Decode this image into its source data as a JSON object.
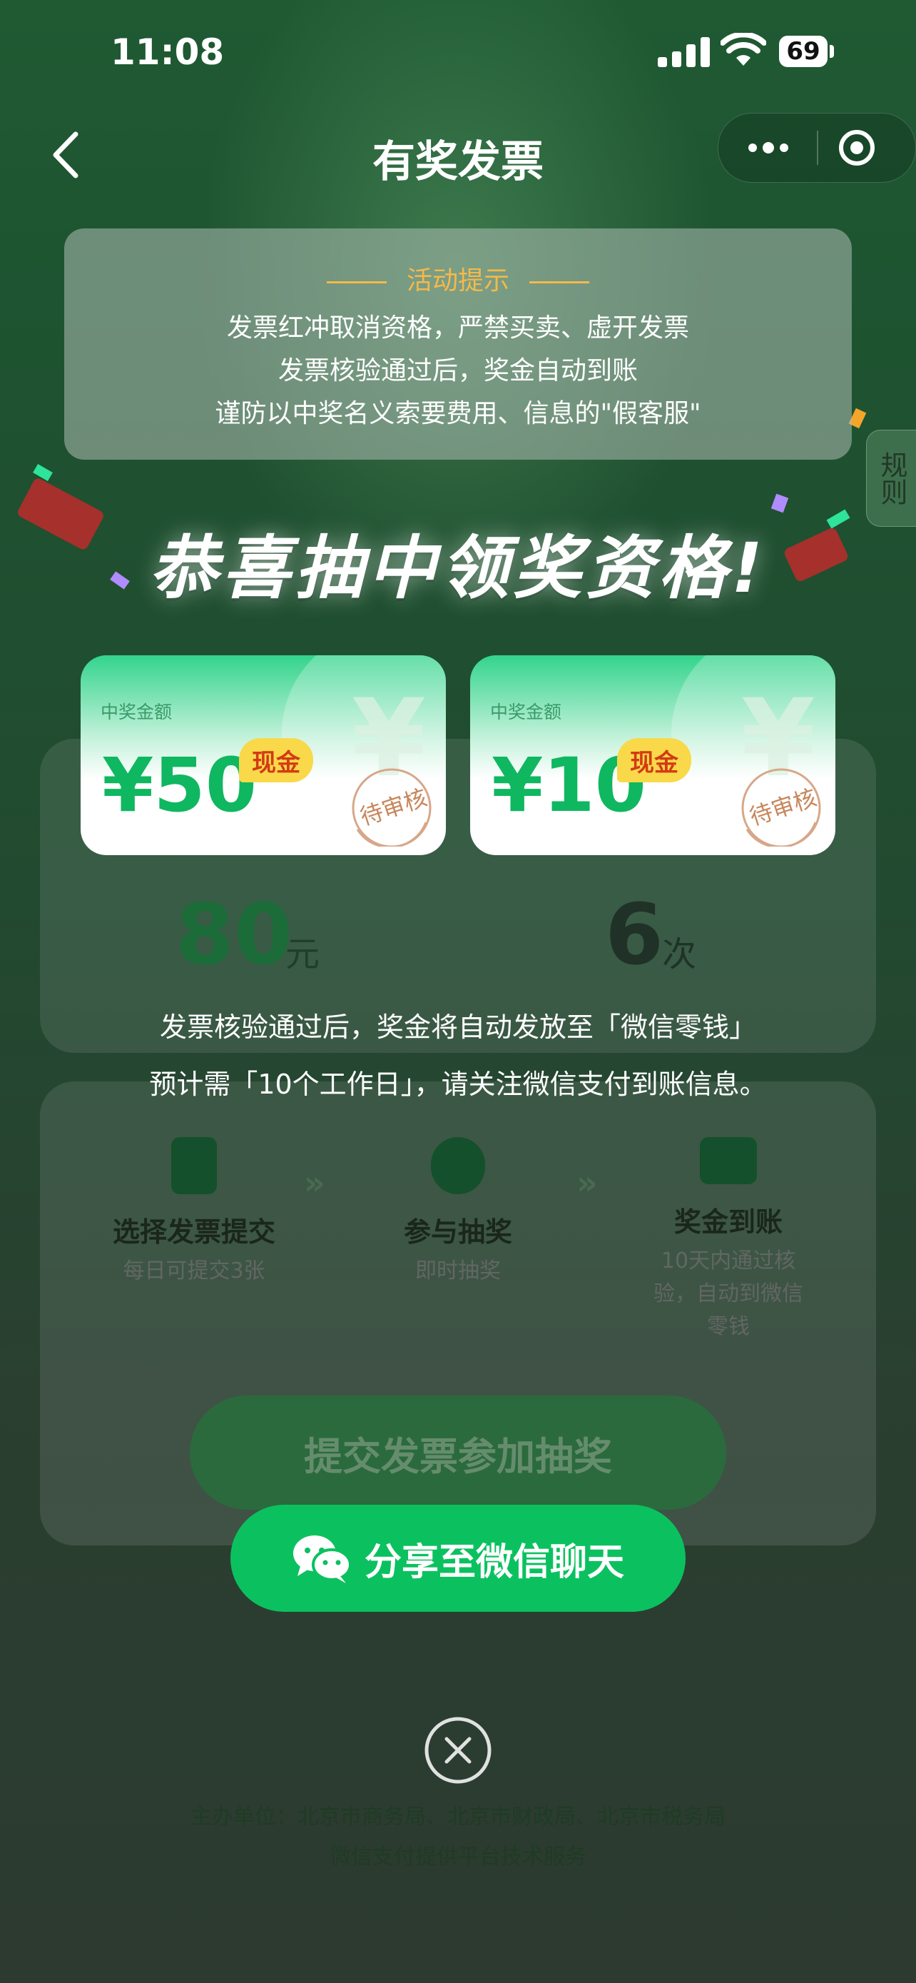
{
  "status_bar": {
    "time": "11:08",
    "battery": "69"
  },
  "nav": {
    "title": "有奖发票"
  },
  "rule_tab": "规则",
  "notice": {
    "heading": "活动提示",
    "lines": [
      "发票红冲取消资格，严禁买卖、虚开发票",
      "发票核验通过后，奖金自动到账",
      "谨防以中奖名义索要费用、信息的\"假客服\""
    ]
  },
  "congrats": "恭喜抽中领奖资格!",
  "prizes": [
    {
      "label": "中奖金额",
      "amount": "¥50",
      "badge": "现金",
      "status": "待审核",
      "decor_symbol": "¥"
    },
    {
      "label": "中奖金额",
      "amount": "¥10",
      "badge": "现金",
      "status": "待审核",
      "decor_symbol": "¥"
    }
  ],
  "success": {
    "line1": "发票核验通过后，奖金将自动发放至「微信零钱」",
    "line2": "预计需「10个工作日」，请关注微信支付到账信息。"
  },
  "share_button": "分享至微信聊天",
  "background": {
    "stat_amount": "80",
    "stat_amount_unit": "元",
    "stat_count": "6",
    "stat_count_unit": "次",
    "steps": [
      {
        "title": "选择发票提交",
        "sub": "每日可提交3张"
      },
      {
        "title": "参与抽奖",
        "sub": "即时抽奖"
      },
      {
        "title": "奖金到账",
        "sub": "10天内通过核验，自动到微信零钱"
      }
    ],
    "submit_button": "提交发票参加抽奖",
    "footer_line1": "主办单位：北京市商务局、北京市财政局、北京市税务局",
    "footer_line2": "微信支付提供平台技术服务"
  },
  "colors": {
    "brand_green": "#0bc15f",
    "notice_accent": "#f4b94a",
    "badge_bg": "#f9d94a",
    "badge_text": "#d33a14"
  }
}
